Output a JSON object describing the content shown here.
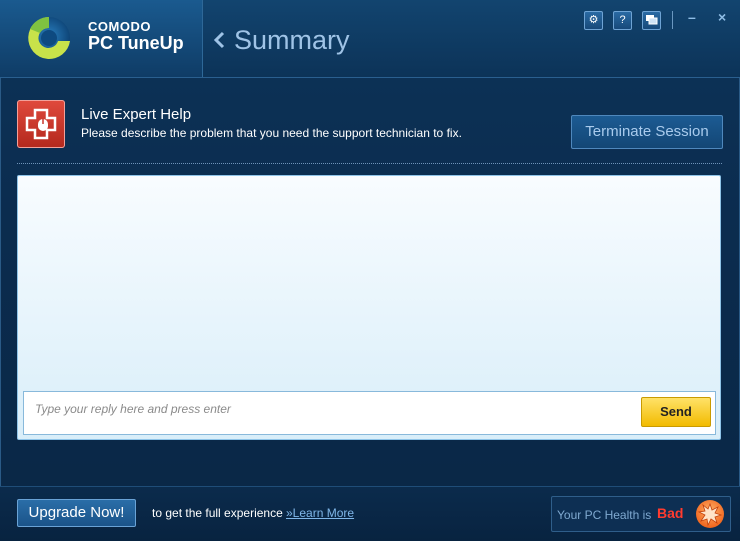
{
  "header": {
    "brand_top": "COMODO",
    "brand_bottom": "PC TuneUp",
    "page_title": "Summary",
    "buttons": {
      "settings": "⚙",
      "help": "?",
      "feedback": "💬"
    },
    "window_controls": {
      "minimize": "–",
      "close": "×"
    }
  },
  "help": {
    "title": "Live Expert Help",
    "description": "Please describe the problem that you need the support technician to fix.",
    "terminate_label": "Terminate Session"
  },
  "chat": {
    "reply_placeholder": "Type your reply here and press enter",
    "send_label": "Send"
  },
  "footer": {
    "upgrade_label": "Upgrade Now!",
    "upgrade_text": "to get the full experience",
    "learn_more": "»Learn More",
    "health_label": "Your PC Health is",
    "health_status": "Bad"
  },
  "colors": {
    "accent": "#1b5489",
    "send_button": "#f2bb00",
    "health_bad": "#ff3b2f",
    "help_icon": "#c9352a"
  },
  "icons": {
    "logo": "comodo-logo",
    "back": "chevron-left-icon",
    "settings": "gear-icon",
    "help": "question-icon",
    "feedback": "chat-bubble-icon",
    "expert": "medical-cross-mouse-icon",
    "health": "alert-burst-icon"
  }
}
